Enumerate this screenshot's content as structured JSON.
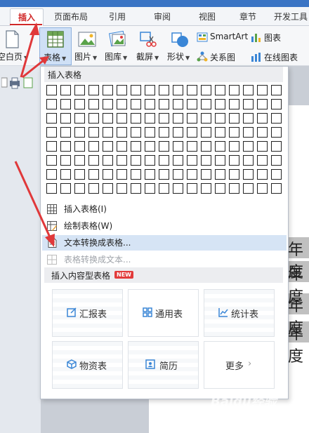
{
  "tabs": [
    {
      "label": "插入",
      "active": true
    },
    {
      "label": "页面布局"
    },
    {
      "label": "引用"
    },
    {
      "label": "审阅"
    },
    {
      "label": "视图"
    },
    {
      "label": "章节"
    },
    {
      "label": "开发工具"
    }
  ],
  "ribbon": {
    "blank_page": "空白页",
    "table": "表格",
    "picture": "图片",
    "gallery": "图库",
    "screenshot": "截屏",
    "shape": "形状",
    "smartart": "SmartArt",
    "chart": "图表",
    "relation_chart": "关系图",
    "online_chart": "在线图表"
  },
  "panel": {
    "header": "插入表格",
    "grid": {
      "rows": 8,
      "cols": 17
    },
    "menu": [
      {
        "label": "插入表格(I)",
        "icon": "table-icon",
        "enabled": true,
        "highlighted": false
      },
      {
        "label": "绘制表格(W)",
        "icon": "pencil-table-icon",
        "enabled": true,
        "highlighted": false
      },
      {
        "label": "文本转换成表格...",
        "icon": "text-to-table-icon",
        "enabled": true,
        "highlighted": true
      },
      {
        "label": "表格转换成文本...",
        "icon": "table-to-text-icon",
        "enabled": false,
        "highlighted": false
      }
    ],
    "section_header": "插入内容型表格",
    "new_badge": "NEW",
    "cards": [
      {
        "label": "汇报表",
        "icon": "edit-square-icon"
      },
      {
        "label": "通用表",
        "icon": "grid-icon"
      },
      {
        "label": "统计表",
        "icon": "line-chart-icon"
      },
      {
        "label": "物资表",
        "icon": "cube-icon"
      },
      {
        "label": "简历",
        "icon": "person-card-icon"
      },
      {
        "label": "更多",
        "icon": "chevron-right-icon"
      }
    ]
  },
  "document": {
    "lines": [
      "年度",
      "年度",
      "年度",
      "年度"
    ]
  },
  "watermark": {
    "text": "Baidu经验",
    "sub": "jingyan.baidu.com"
  },
  "colors": {
    "accent": "#d02828",
    "highlight": "#d6e4f5",
    "icon_blue": "#3a86d6",
    "arrow": "#e0383a"
  }
}
